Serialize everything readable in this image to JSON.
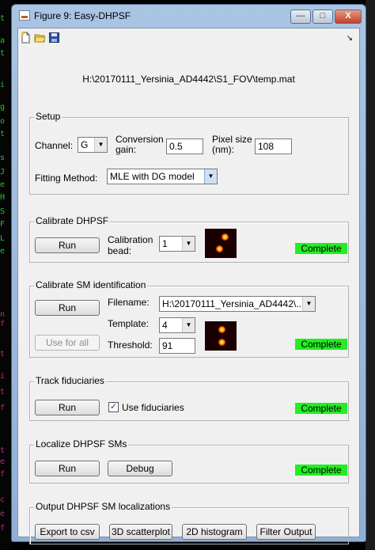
{
  "window": {
    "title": "Figure 9: Easy-DHPSF",
    "controls": {
      "minimize": "—",
      "maximize": "□",
      "close": "X"
    }
  },
  "toolbar": {
    "icons": [
      "new-file-icon",
      "open-folder-icon",
      "save-icon"
    ],
    "dock_arrow": "↘"
  },
  "file_path": "H:\\20170111_Yersinia_AD4442\\S1_FOV\\temp.mat",
  "setup": {
    "title": "Setup",
    "channel_label": "Channel:",
    "channel_value": "G",
    "conversion_gain_label_1": "Conversion",
    "conversion_gain_label_2": "gain:",
    "conversion_gain_value": "0.5",
    "pixel_size_label_1": "Pixel size",
    "pixel_size_label_2": "(nm):",
    "pixel_size_value": "108",
    "fitting_method_label": "Fitting Method:",
    "fitting_method_value": "MLE with DG model"
  },
  "calibrate_dhpsf": {
    "title": "Calibrate DHPSF",
    "run_label": "Run",
    "bead_label_1": "Calibration",
    "bead_label_2": "bead:",
    "bead_value": "1",
    "status": "Complete"
  },
  "calibrate_sm": {
    "title": "Calibrate SM identification",
    "run_label": "Run",
    "use_for_all_label": "Use for all",
    "filename_label": "Filename:",
    "filename_value": "H:\\20170111_Yersinia_AD4442\\...",
    "template_label": "Template:",
    "template_value": "4",
    "threshold_label": "Threshold:",
    "threshold_value": "91",
    "status": "Complete"
  },
  "track_fiduciaries": {
    "title": "Track fiduciaries",
    "run_label": "Run",
    "checkbox_mark": "✓",
    "checkbox_label": "Use fiduciaries",
    "checked": true,
    "status": "Complete"
  },
  "localize": {
    "title": "Localize DHPSF SMs",
    "run_label": "Run",
    "debug_label": "Debug",
    "status": "Complete"
  },
  "output": {
    "title": "Output DHPSF SM localizations",
    "export_label": "Export to csv",
    "scatter_label": "3D scatterplot",
    "histogram_label": "2D histogram",
    "filter_label": "Filter Output"
  },
  "colors": {
    "status_green": "#22ee22",
    "title_bar": "#a9c5e3",
    "panel_bg": "#f0f0f0"
  }
}
